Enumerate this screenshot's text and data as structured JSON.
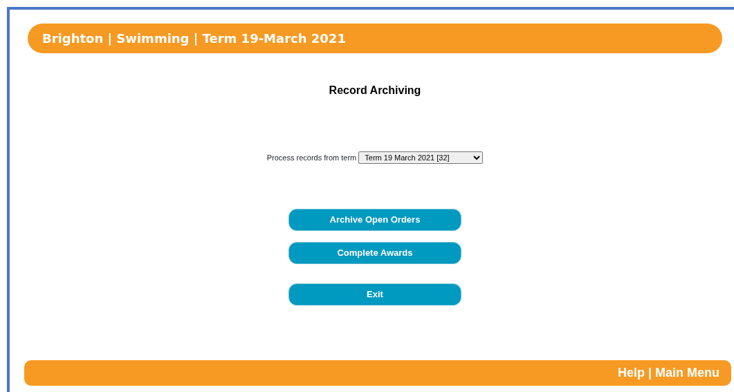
{
  "header": {
    "title": "Brighton | Swimming | Term 19-March 2021"
  },
  "page_title": "Record Archiving",
  "term_select": {
    "label": "Process records from term",
    "value": "Term 19 March 2021 [32]"
  },
  "button_groups": [
    [
      "Archive Open Orders",
      "Complete Awards"
    ],
    [
      "Exit"
    ]
  ],
  "footer": {
    "links": [
      "Help",
      "Main Menu"
    ],
    "separator": "|"
  }
}
